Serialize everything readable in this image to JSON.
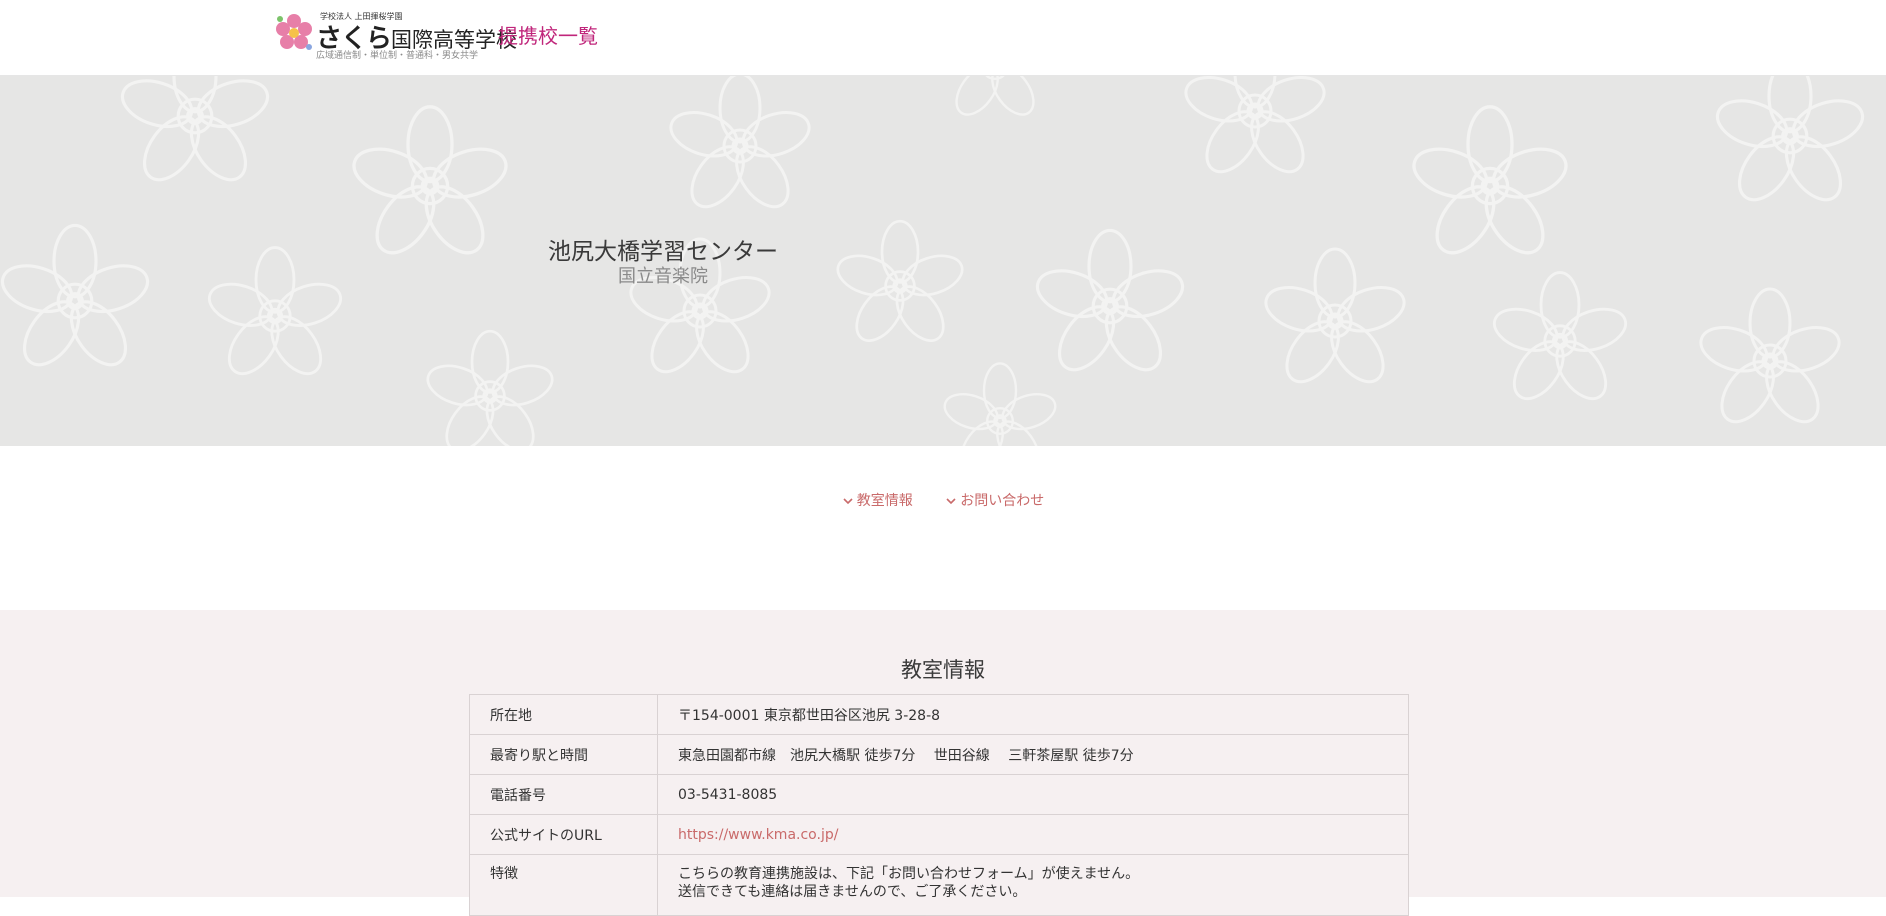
{
  "header": {
    "logo_small": "学校法人 上田揮桜学園",
    "logo_sakura": "さくら",
    "logo_school": "国際高等学校",
    "logo_sub": "広域通信制・単位制・普通科・男女共学",
    "title": "提携校一覧"
  },
  "hero": {
    "title": "池尻大橋学習センター",
    "subtitle": "国立音楽院"
  },
  "anchor_nav": {
    "items": [
      {
        "label": "教室情報"
      },
      {
        "label": "お問い合わせ"
      }
    ]
  },
  "info": {
    "title": "教室情報",
    "rows": [
      {
        "label": "所在地",
        "value": "〒154-0001 東京都世田谷区池尻 3-28-8"
      },
      {
        "label": "最寄り駅と時間",
        "value": "東急田園都市線　池尻大橋駅 徒歩7分　 世田谷線　 三軒茶屋駅 徒歩7分"
      },
      {
        "label": "電話番号",
        "value": "03-5431-8085"
      },
      {
        "label": "公式サイトのURL",
        "value": "https://www.kma.co.jp/"
      },
      {
        "label": "特徴",
        "value_line1": "こちらの教育連携施設は、下記「お問い合わせフォーム」が使えません。",
        "value_line2": "送信できても連絡は届きませんので、ご了承ください。"
      }
    ]
  },
  "colors": {
    "brand": "#c0267b",
    "link": "#c96a6a",
    "hero_bg": "#e6e6e5",
    "section_bg": "#f6f0f1"
  }
}
